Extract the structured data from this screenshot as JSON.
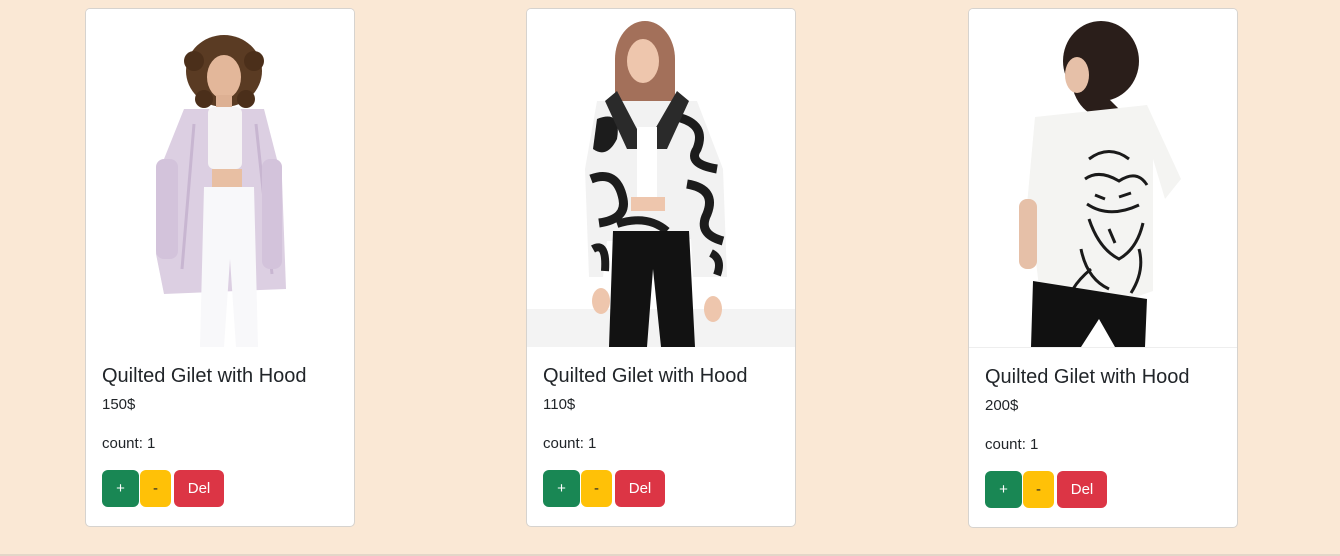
{
  "products": [
    {
      "title": "Quilted Gilet with Hood",
      "price": "150$",
      "count": "count: 1",
      "image": "model-lilac-coat-photo",
      "buttons": {
        "plus": "+",
        "minus": "-",
        "del": "Del"
      }
    },
    {
      "title": "Quilted Gilet with Hood",
      "price": "110$",
      "count": "count: 1",
      "image": "model-zebra-jacket-photo",
      "buttons": {
        "plus": "+",
        "minus": "-",
        "del": "Del"
      }
    },
    {
      "title": "Quilted Gilet with Hood",
      "price": "200$",
      "count": "count: 1",
      "image": "model-white-tshirt-photo",
      "buttons": {
        "plus": "+",
        "minus": "-",
        "del": "Del"
      }
    }
  ],
  "colors": {
    "page_background": "#fae8d5",
    "plus_button": "#198754",
    "minus_button": "#ffc107",
    "delete_button": "#dc3545"
  }
}
